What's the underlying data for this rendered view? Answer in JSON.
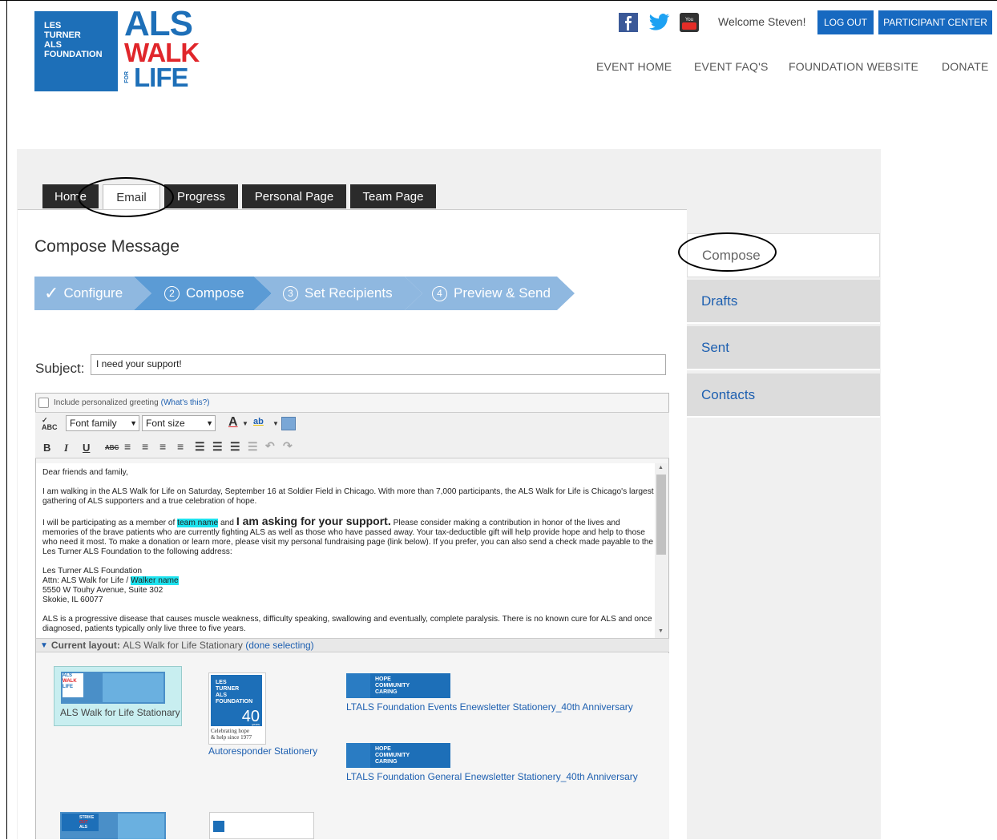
{
  "header": {
    "logo_lines": [
      "LES",
      "TURNER",
      "ALS",
      "FOUNDATION"
    ],
    "walk_logo": {
      "als": "ALS",
      "walk": "WALK",
      "for": "FOR",
      "life": "LIFE"
    },
    "welcome": "Welcome Steven!",
    "logout": "LOG OUT",
    "participant_center": "PARTICIPANT CENTER",
    "nav": [
      "EVENT HOME",
      "EVENT FAQ'S",
      "FOUNDATION WEBSITE",
      "DONATE"
    ]
  },
  "tabs": [
    "Home",
    "Email",
    "Progress",
    "Personal Page",
    "Team Page"
  ],
  "page_title": "Compose Message",
  "steps": [
    {
      "num": "✓",
      "label": "Configure"
    },
    {
      "num": "2",
      "label": "Compose"
    },
    {
      "num": "3",
      "label": "Set Recipients"
    },
    {
      "num": "4",
      "label": "Preview & Send"
    }
  ],
  "subject": {
    "label": "Subject:",
    "value": "I need your support!"
  },
  "editor": {
    "greeting_checkbox_label": "Include personalized greeting",
    "whats_this": "(What's this?)",
    "font_family": "Font family",
    "font_size": "Font size",
    "body": {
      "p1": "Dear friends and family,",
      "p2": "I am walking in the ALS Walk for Life on Saturday, September 16 at Soldier Field in Chicago. With more than 7,000 participants, the ALS Walk for Life is Chicago's largest gathering of ALS supporters and a true celebration of hope.",
      "p3a": "I will be participating as a member of ",
      "p3_team": "team name",
      "p3b": " and ",
      "p3_big": "I am asking for your support.",
      "p3c": " Please consider making a contribution in honor of the lives and memories of the brave patients who are currently fighting ALS as well as those who have passed away. Your tax-deductible gift will help provide hope and help to those who need it most. To make a donation or learn more, please visit my personal fundraising page (link below). If you prefer, you can also send a check made payable to the Les Turner ALS Foundation to the following address:",
      "addr1": "Les Turner ALS Foundation",
      "addr2a": "Attn: ALS Walk for Life / ",
      "addr2_walker": "Walker name",
      "addr3": "5550 W Touhy Avenue, Suite 302",
      "addr4": "Skokie, IL 60077",
      "p4": "ALS is a progressive disease that causes muscle weakness, difficulty speaking, swallowing and eventually, complete paralysis. There is no known cure for ALS and once diagnosed, patients typically only live three to five years."
    },
    "layout_prefix": "Current layout:",
    "layout_name": "ALS Walk for Life Stationary",
    "done_selecting": "(done selecting)"
  },
  "stationery": [
    {
      "label": "ALS Walk for Life Stationary"
    },
    {
      "label": "Autoresponder Stationery"
    },
    {
      "label": "LTALS Foundation Events Enewsletter Stationery_40th Anniversary"
    },
    {
      "label": "LTALS Foundation General Enewsletter Stationery_40th Anniversary"
    }
  ],
  "thumb_text": {
    "walk_logo": [
      "ALS",
      "WALK",
      "LIFE"
    ],
    "foundation_logo": [
      "LES",
      "TURNER",
      "ALS",
      "FOUNDATION"
    ],
    "forty": "40",
    "years": "years",
    "celebrating": [
      "Celebrating hope",
      "& help since 1977"
    ],
    "banner": [
      "HOPE",
      "COMMUNITY",
      "CARING"
    ],
    "strike": [
      "STRIKE",
      "OUT",
      "ALS"
    ]
  },
  "sidebar": [
    "Compose",
    "Drafts",
    "Sent",
    "Contacts"
  ],
  "colors": {
    "primary": "#1769c0",
    "step": "#5b9bd5",
    "step_light": "#8fb8e0"
  }
}
